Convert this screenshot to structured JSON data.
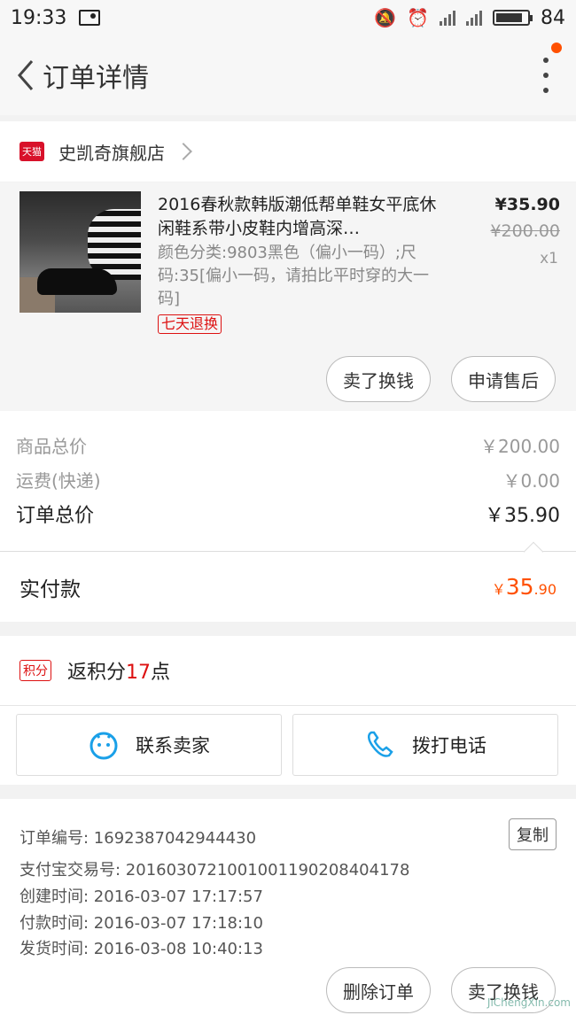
{
  "status_bar": {
    "time": "19:33",
    "battery": "84",
    "battery_level": 0.84
  },
  "header": {
    "title": "订单详情"
  },
  "shop": {
    "badge": "天猫",
    "name": "史凯奇旗舰店"
  },
  "product": {
    "title": "2016春秋款韩版潮低帮单鞋女平底休闲鞋系带小皮鞋内增高深…",
    "sku": "颜色分类:9803黑色（偏小一码）;尺码:35[偏小一码，请拍比平时穿的大一码]",
    "tag": "七天退换",
    "price": "¥35.90",
    "original_price": "¥200.00",
    "quantity": "x1",
    "btn_sell": "卖了换钱",
    "btn_after": "申请售后"
  },
  "totals": {
    "goods_label": "商品总价",
    "goods_value": "￥200.00",
    "shipping_label": "运费(快递)",
    "shipping_value": "￥0.00",
    "order_label": "订单总价",
    "order_value": "￥35.90"
  },
  "paid": {
    "label": "实付款",
    "currency": "￥",
    "int": "35",
    "dec": ".90"
  },
  "points": {
    "badge": "积分",
    "prefix": "返积分",
    "num": "17",
    "suffix": "点"
  },
  "contact": {
    "seller": "联系卖家",
    "phone": "拨打电话"
  },
  "info": {
    "order_no": "订单编号: 1692387042944430",
    "alipay_no": "支付宝交易号: 2016030721001001190208404178",
    "created": "创建时间: 2016-03-07 17:17:57",
    "paid": "付款时间: 2016-03-07 17:18:10",
    "shipped": "发货时间: 2016-03-08 10:40:13",
    "copy": "复制"
  },
  "bottom": {
    "delete": "删除订单",
    "sell": "卖了换钱"
  },
  "watermark": "JiChengXin.com",
  "colors": {
    "accent": "#ff5000",
    "tmall_red": "#d8112a",
    "tag_red": "#dd1111",
    "icon_blue": "#1aa0e8"
  }
}
